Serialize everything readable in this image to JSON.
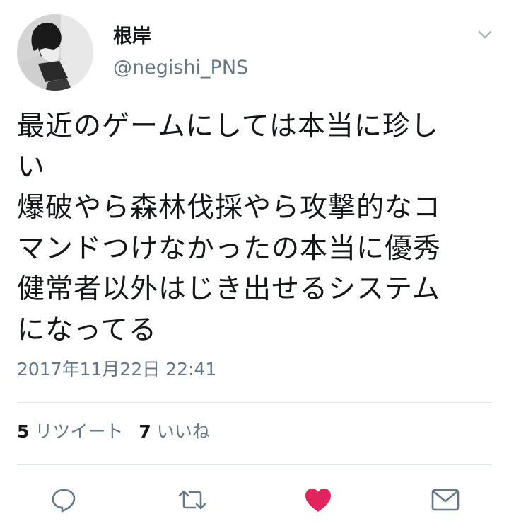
{
  "author": {
    "display_name": "根岸",
    "handle": "@negishi_PNS",
    "avatar_icon": "avatar-illustration"
  },
  "tweet": {
    "lines": [
      "最近のゲームにしては本当に珍し",
      "い",
      "爆破やら森林伐採やら攻撃的なコ",
      "マンドつけなかったの本当に優秀",
      "健常者以外はじき出せるシステム",
      "になってる"
    ],
    "timestamp": "2017年11月22日 22:41"
  },
  "stats": {
    "retweet_count": "5",
    "retweet_label": "リツイート",
    "like_count": "7",
    "like_label": "いいね"
  },
  "actions": {
    "reply_icon": "reply-icon",
    "retweet_icon": "retweet-icon",
    "like_icon": "heart-icon",
    "dm_icon": "envelope-icon",
    "like_color": "#e0245e",
    "icon_color": "#657786"
  }
}
